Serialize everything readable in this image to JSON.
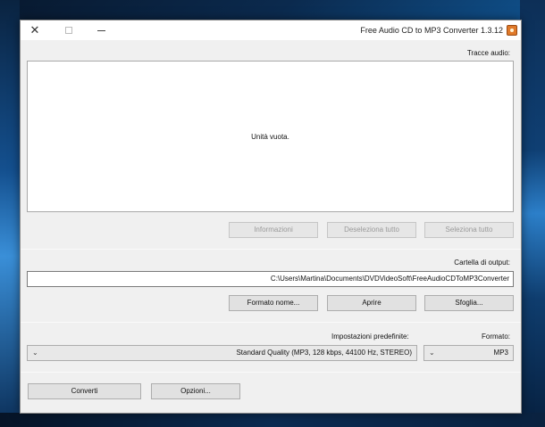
{
  "window": {
    "title": "Free Audio CD to MP3 Converter 1.3.12",
    "close_glyph": "✕",
    "colors": {
      "accent_icon": "#e07a2a",
      "background": "#f0f0f0"
    }
  },
  "tracks": {
    "label": "Tracce audio:",
    "empty_message": "Unità vuota."
  },
  "track_buttons": {
    "select_all": "Seleziona tutto",
    "deselect_all": "Deseleziona tutto",
    "info": "Informazioni"
  },
  "output": {
    "label": "Cartella di output:",
    "path": "C:\\Users\\Martina\\Documents\\DVDVideoSoft\\FreeAudioCDToMP3Converter",
    "browse": "Sfoglia...",
    "open": "Aprire",
    "name_format": "Formato nome..."
  },
  "settings": {
    "format_label": "Formato:",
    "format_value": "MP3",
    "preset_label": "Impostazioni predefinite:",
    "preset_value": "Standard Quality (MP3, 128 kbps, 44100 Hz, STEREO)"
  },
  "actions": {
    "convert": "Converti",
    "options": "Opzioni..."
  }
}
